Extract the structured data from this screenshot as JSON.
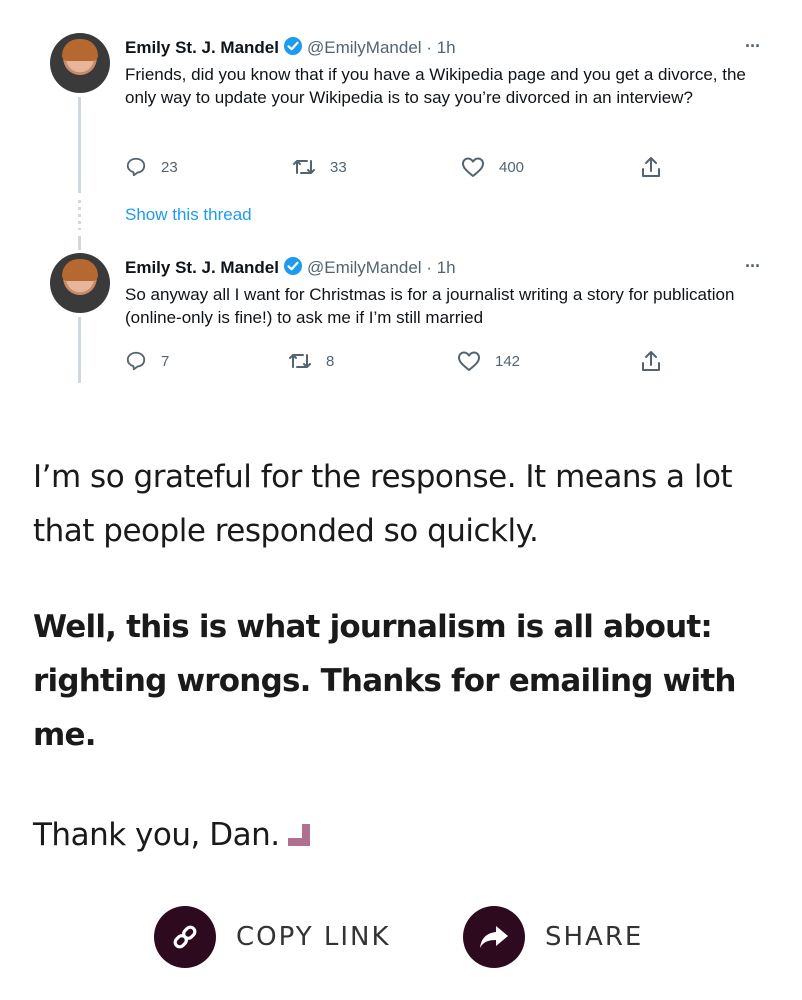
{
  "tweets": [
    {
      "name": "Emily St. J. Mandel",
      "handle": "@EmilyMandel",
      "time": "· 1h",
      "more": "···",
      "text": "Friends, did you know that if you have a Wikipedia page and you get a divorce, the only way to update your Wikipedia is to say you’re divorced in an interview?",
      "replies": "23",
      "retweets": "33",
      "likes": "400"
    },
    {
      "name": "Emily St. J. Mandel",
      "handle": "@EmilyMandel",
      "time": "· 1h",
      "more": "···",
      "text": "So anyway all I want for Christmas is for a journalist writing a story for publication (online-only is fine!) to ask me if I’m still married",
      "replies": "7",
      "retweets": "8",
      "likes": "142"
    }
  ],
  "show_thread": "Show this thread",
  "article": {
    "p1": "I’m so grateful for the response. It means a lot that people responded so quickly.",
    "p2": "Well, this is what journalism is all about: righting wrongs. Thanks for emailing with me.",
    "p3": "Thank you, Dan."
  },
  "actions": {
    "copy_link": "COPY LINK",
    "share": "SHARE"
  },
  "colors": {
    "link_blue": "#1d9bf0",
    "verified_blue": "#1d9bf0",
    "button_bg": "#2e0a1f",
    "end_mark": "#b0708f"
  }
}
